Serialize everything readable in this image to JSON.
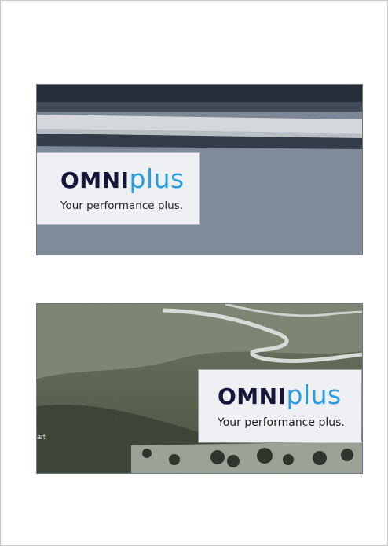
{
  "slides": [
    {
      "brand": {
        "part1": "OMNI",
        "part2": "plus"
      },
      "tagline": "Your performance plus."
    },
    {
      "brand": {
        "part1": "OMNI",
        "part2": "plus"
      },
      "tagline": "Your performance plus.",
      "edge_text": "art"
    }
  ],
  "colors": {
    "brand_dark": "#16163a",
    "brand_blue": "#2a9be0",
    "logo_box": "#eef0f3"
  }
}
